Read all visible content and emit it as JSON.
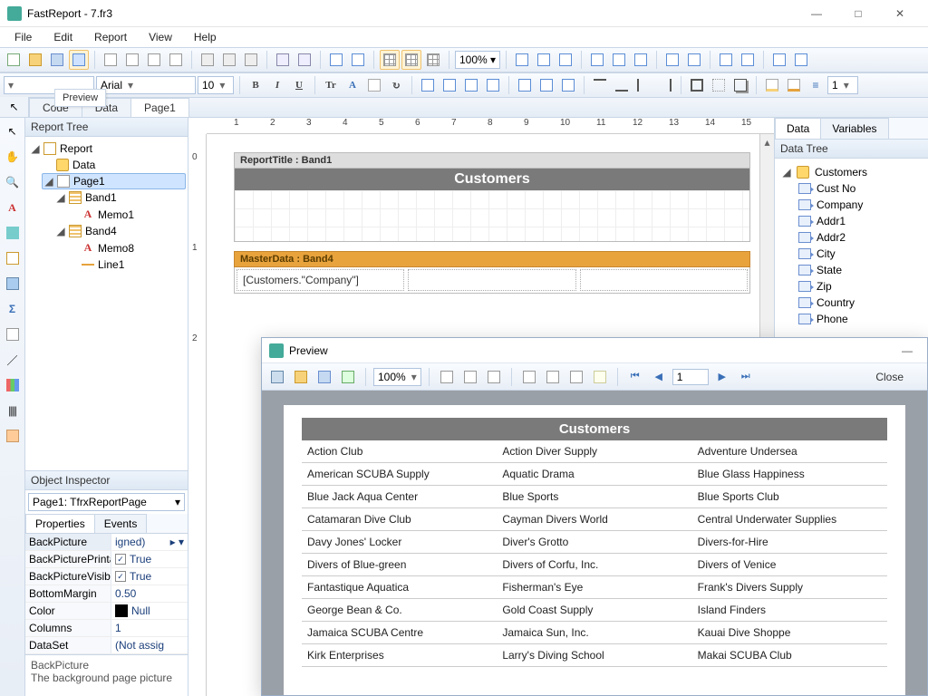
{
  "window": {
    "title": "FastReport - 7.fr3",
    "min": "—",
    "max": "□",
    "close": "✕"
  },
  "menu": [
    "File",
    "Edit",
    "Report",
    "View",
    "Help"
  ],
  "zoom": "100%  ▾",
  "font_family": "Arial",
  "font_size": "10",
  "line_width": "1",
  "tooltip": "Preview",
  "tabs_left": {
    "code": "Code",
    "data": "Data",
    "page": "Page1"
  },
  "report_tree": {
    "title": "Report Tree",
    "root": "Report",
    "data": "Data",
    "page": "Page1",
    "band1": "Band1",
    "memo1": "Memo1",
    "band4": "Band4",
    "memo8": "Memo8",
    "line1": "Line1"
  },
  "inspector": {
    "title": "Object Inspector",
    "obj": "Page1: TfrxReportPage",
    "tab_props": "Properties",
    "tab_events": "Events",
    "rows": [
      {
        "k": "BackPicture",
        "v": "igned)",
        "hdr": true,
        "extra": "▸ ▾"
      },
      {
        "k": "BackPicturePrintal",
        "v": "True",
        "chk": true
      },
      {
        "k": "BackPictureVisible",
        "v": "True",
        "chk": true
      },
      {
        "k": "BottomMargin",
        "v": "0.50"
      },
      {
        "k": "Color",
        "v": "Null",
        "swatch": "#000"
      },
      {
        "k": "Columns",
        "v": "1"
      },
      {
        "k": "DataSet",
        "v": "(Not assig"
      }
    ],
    "help_k": "BackPicture",
    "help_v": "The background page picture"
  },
  "design": {
    "report_title_label": "ReportTitle : Band1",
    "title_text": "Customers",
    "master_label": "MasterData : Band4",
    "expr": "[Customers.\"Company\"]"
  },
  "right": {
    "tab_data": "Data",
    "tab_vars": "Variables",
    "title": "Data Tree",
    "root": "Customers",
    "fields": [
      "Cust No",
      "Company",
      "Addr1",
      "Addr2",
      "City",
      "State",
      "Zip",
      "Country",
      "Phone"
    ]
  },
  "preview": {
    "title": "Preview",
    "zoom": "100%",
    "page_no": "1",
    "close": "Close",
    "heading": "Customers",
    "rows": [
      [
        "Action Club",
        "Action Diver Supply",
        "Adventure Undersea"
      ],
      [
        "American SCUBA Supply",
        "Aquatic Drama",
        "Blue Glass Happiness"
      ],
      [
        "Blue Jack Aqua Center",
        "Blue Sports",
        "Blue Sports Club"
      ],
      [
        "Catamaran Dive Club",
        "Cayman Divers World",
        "Central Underwater Supplies"
      ],
      [
        "Davy Jones' Locker",
        "Diver's Grotto",
        "Divers-for-Hire"
      ],
      [
        "Divers of Blue-green",
        "Divers of Corfu, Inc.",
        "Divers of Venice"
      ],
      [
        "Fantastique Aquatica",
        "Fisherman's Eye",
        "Frank's Divers Supply"
      ],
      [
        "George Bean & Co.",
        "Gold Coast Supply",
        "Island Finders"
      ],
      [
        "Jamaica SCUBA Centre",
        "Jamaica Sun, Inc.",
        "Kauai Dive Shoppe"
      ],
      [
        "Kirk Enterprises",
        "Larry's Diving School",
        "Makai SCUBA Club"
      ]
    ]
  },
  "ruler_ticks": [
    "1",
    "2",
    "3",
    "4",
    "5",
    "6",
    "7",
    "8",
    "9",
    "10",
    "11",
    "12",
    "13",
    "14",
    "15"
  ],
  "vticks": [
    "0",
    "1",
    "2"
  ]
}
